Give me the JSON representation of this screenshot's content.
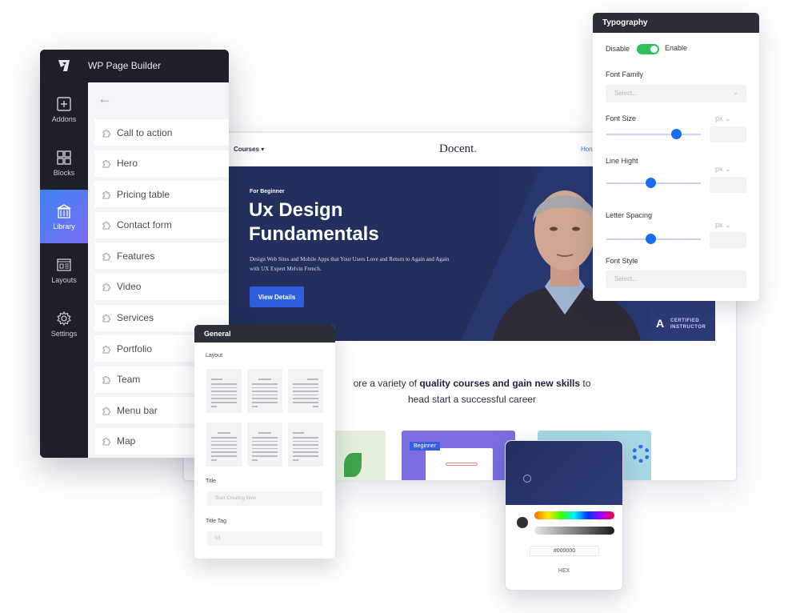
{
  "builder": {
    "title": "WP Page Builder",
    "rail": [
      {
        "id": "addons",
        "label": "Addons",
        "icon": "plus-square-icon",
        "active": false
      },
      {
        "id": "blocks",
        "label": "Blocks",
        "icon": "blocks-grid-icon",
        "active": false
      },
      {
        "id": "library",
        "label": "Library",
        "icon": "library-icon",
        "active": true
      },
      {
        "id": "layouts",
        "label": "Layouts",
        "icon": "layout-icon",
        "active": false
      },
      {
        "id": "settings",
        "label": "Settings",
        "icon": "gear-icon",
        "active": false
      }
    ],
    "back_icon": "arrow-left-icon",
    "addons": [
      "Call to action",
      "Hero",
      "Pricing table",
      "Contact form",
      "Features",
      "Video",
      "Services",
      "Portfolio",
      "Team",
      "Menu bar",
      "Map"
    ]
  },
  "site": {
    "nav": {
      "courses": "Courses ▾",
      "logo": "Docent",
      "logo_dot": ".",
      "home": "Hon"
    },
    "hero": {
      "tag": "For Beginner",
      "title_line1": "Ux Design",
      "title_line2": "Fundamentals",
      "description": "Design Web Sites and Mobile Apps that Your Users Love and Return to Again and Again with UX Expert Melvin French.",
      "cta": "View Details",
      "badge_line1": "CERTIFIED",
      "badge_line2": "INSTRUCTOR",
      "badge_logo": "A"
    },
    "tagline": {
      "pre": "ore a variety of ",
      "bold": "quality courses and gain new skills",
      "post": " to",
      "line2": "head start a successful career"
    },
    "course_badge": "Beginner"
  },
  "general": {
    "title": "General",
    "layout_label": "Layout",
    "title_label": "Title",
    "title_placeholder": "Start Creating Now",
    "title_tag_label": "Title Tag",
    "title_tag_value": "h3"
  },
  "typography": {
    "title": "Typography",
    "disable": "Disable",
    "enable": "Enable",
    "toggle_on": true,
    "font_family_label": "Font Family",
    "font_family_placeholder": "Select...",
    "font_size_label": "Font Size",
    "font_size_unit": "px",
    "font_size_slider": 0.74,
    "line_height_label": "Line Hight",
    "line_height_unit": "px",
    "line_height_slider": 0.47,
    "letter_spacing_label": "Letter Spacing",
    "letter_spacing_unit": "px",
    "letter_spacing_slider": 0.47,
    "font_style_label": "Font Style",
    "font_style_placeholder": "Select..."
  },
  "color_picker": {
    "selected_color": "#2e3034",
    "hex_value": "#000000",
    "mode_label": "HEX",
    "field_color": "#25305f"
  }
}
